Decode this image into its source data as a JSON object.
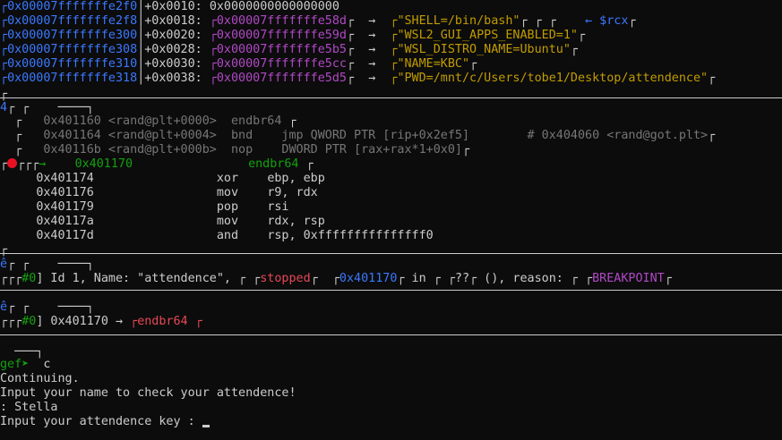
{
  "stack": [
    {
      "addr": "0x00007fffffffe2f0",
      "off": "+0x0010:",
      "val": "0x0000000000000000",
      "arrow": "",
      "str": "",
      "tail": ""
    },
    {
      "addr": "0x00007fffffffe2f8",
      "off": "+0x0018:",
      "val": "0x00007fffffffe58d",
      "arrow": "→",
      "str": "\"SHELL=/bin/bash\"",
      "tail": "← $rcx"
    },
    {
      "addr": "0x00007fffffffe300",
      "off": "+0x0020:",
      "val": "0x00007fffffffe59d",
      "arrow": "→",
      "str": "\"WSL2_GUI_APPS_ENABLED=1\"",
      "tail": ""
    },
    {
      "addr": "0x00007fffffffe308",
      "off": "+0x0028:",
      "val": "0x00007fffffffe5b5",
      "arrow": "→",
      "str": "\"WSL_DISTRO_NAME=Ubuntu\"",
      "tail": ""
    },
    {
      "addr": "0x00007fffffffe310",
      "off": "+0x0030:",
      "val": "0x00007fffffffe5cc",
      "arrow": "→",
      "str": "\"NAME=KBC\"",
      "tail": ""
    },
    {
      "addr": "0x00007fffffffe318",
      "off": "+0x0038:",
      "val": "0x00007fffffffe5d5",
      "arrow": "→",
      "str": "\"PWD=/mnt/c/Users/tobe1/Desktop/attendence\"",
      "tail": ""
    }
  ],
  "code": {
    "previous": [
      {
        "text": "0x401160 <rand@plt+0000>  endbr64",
        "comment": ""
      },
      {
        "text": "0x401164 <rand@plt+0004>  bnd    jmp QWORD PTR [rip+0x2ef5]",
        "comment": "# 0x404060 <rand@got.plt>"
      },
      {
        "text": "0x40116b <rand@plt+000b>  nop    DWORD PTR [rax+rax*1+0x0]",
        "comment": ""
      }
    ],
    "current": {
      "arrow": "→",
      "addr": "0x401170",
      "instr": "endbr64"
    },
    "next": [
      {
        "addr": "0x401174",
        "mnem": "xor",
        "ops": "ebp, ebp"
      },
      {
        "addr": "0x401176",
        "mnem": "mov",
        "ops": "r9, rdx"
      },
      {
        "addr": "0x401179",
        "mnem": "pop",
        "ops": "rsi"
      },
      {
        "addr": "0x40117a",
        "mnem": "mov",
        "ops": "rdx, rsp"
      },
      {
        "addr": "0x40117d",
        "mnem": "and",
        "ops": "rsp, 0xfffffffffffffff0"
      }
    ]
  },
  "threads": {
    "idx": "#0",
    "text": "] Id 1, Name: \"attendence\",",
    "state": "stopped",
    "addr": "0x401170",
    "in": "in",
    "func": "??",
    "args": "(), reason:",
    "reason": "BREAKPOINT"
  },
  "trace": {
    "idx": "#0",
    "addr": "] 0x401170 →",
    "instr": "endbr64"
  },
  "console": {
    "prompt": "gef➤",
    "cmd": "c",
    "lines": [
      "Continuing.",
      "Input your name to check your attendence!",
      ": Stella"
    ],
    "last": "Input your attendence key : "
  },
  "colors": {
    "blue": "#3b78ff",
    "magenta": "#b148c6",
    "yellow": "#c19c00",
    "green": "#13a10e",
    "red": "#e74856",
    "gray": "#767676"
  }
}
